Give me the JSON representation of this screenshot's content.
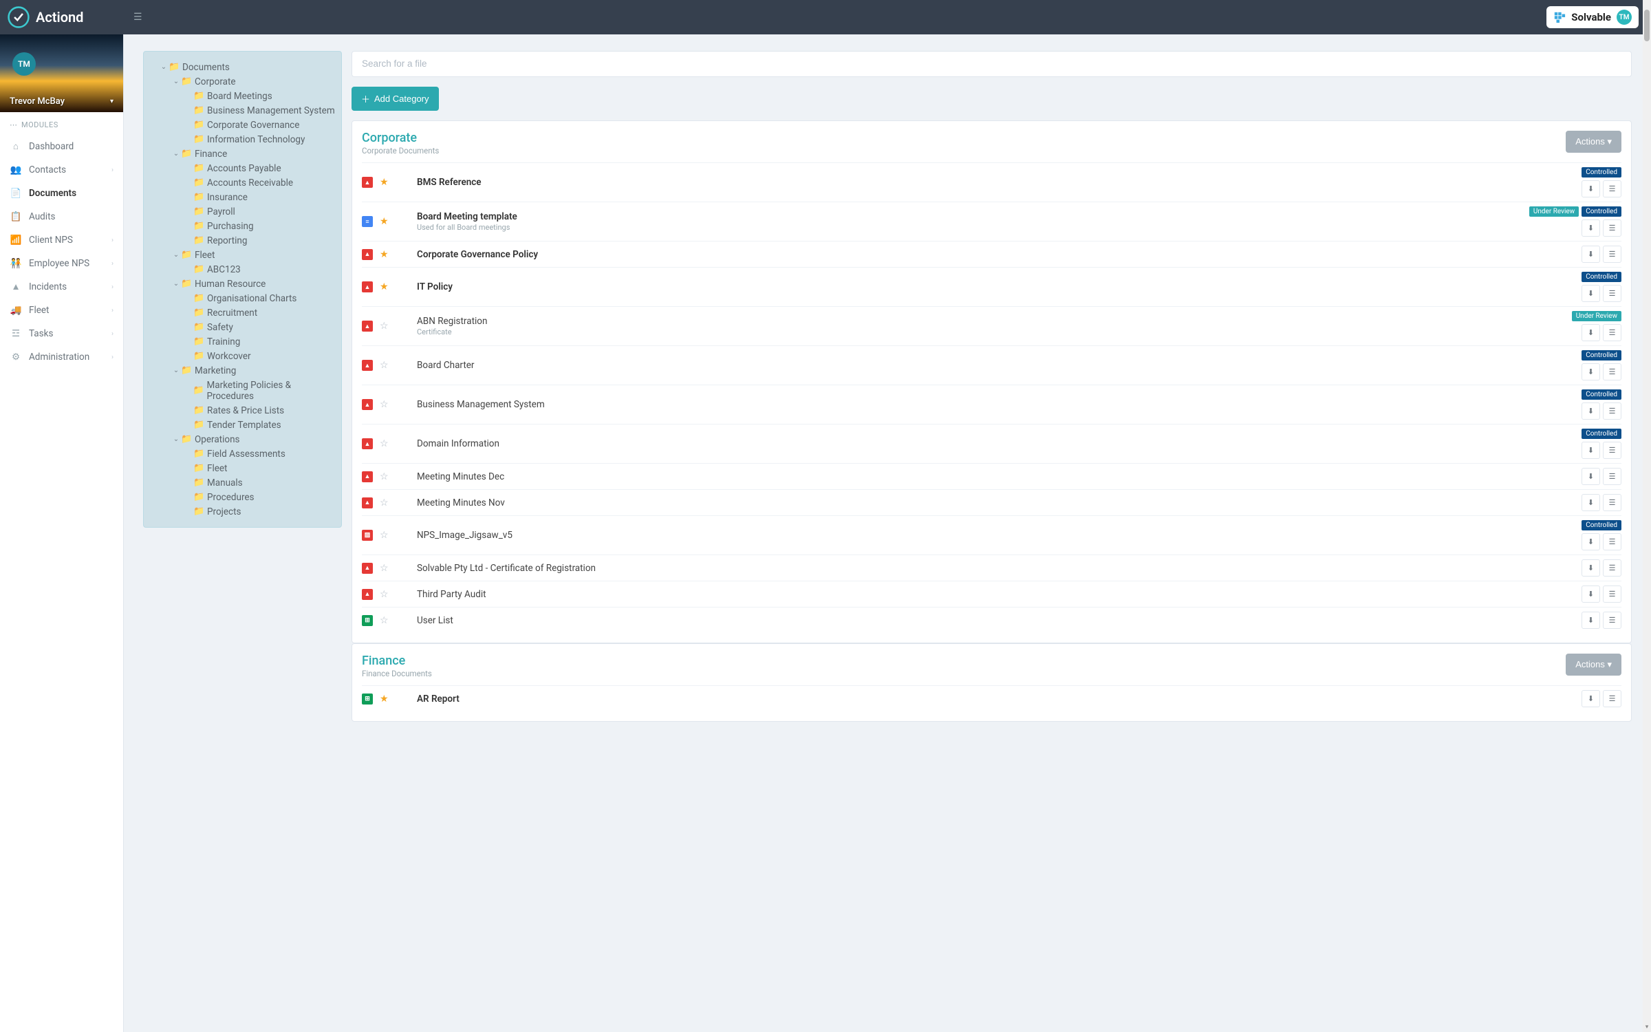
{
  "brand": {
    "name": "Actiond",
    "partner": "Solvable",
    "partner_badge": "TM"
  },
  "user": {
    "initials": "TM",
    "name": "Trevor McBay"
  },
  "sidebar": {
    "section_label": "MODULES",
    "items": [
      {
        "label": "Dashboard",
        "icon": "home-icon",
        "expand": false
      },
      {
        "label": "Contacts",
        "icon": "users-icon",
        "expand": true
      },
      {
        "label": "Documents",
        "icon": "file-icon",
        "expand": false,
        "active": true
      },
      {
        "label": "Audits",
        "icon": "clipboard-icon",
        "expand": false
      },
      {
        "label": "Client NPS",
        "icon": "gauge-icon",
        "expand": true
      },
      {
        "label": "Employee NPS",
        "icon": "group-icon",
        "expand": true
      },
      {
        "label": "Incidents",
        "icon": "warning-icon",
        "expand": true
      },
      {
        "label": "Fleet",
        "icon": "truck-icon",
        "expand": true
      },
      {
        "label": "Tasks",
        "icon": "tasks-icon",
        "expand": true
      },
      {
        "label": "Administration",
        "icon": "cogs-icon",
        "expand": true
      }
    ]
  },
  "tree": {
    "root": "Documents",
    "folders": [
      {
        "name": "Corporate",
        "children": [
          "Board Meetings",
          "Business Management System",
          "Corporate Governance",
          "Information Technology"
        ]
      },
      {
        "name": "Finance",
        "children": [
          "Accounts Payable",
          "Accounts Receivable",
          "Insurance",
          "Payroll",
          "Purchasing",
          "Reporting"
        ]
      },
      {
        "name": "Fleet",
        "children": [
          "ABC123"
        ]
      },
      {
        "name": "Human Resource",
        "children": [
          "Organisational Charts",
          "Recruitment",
          "Safety",
          "Training",
          "Workcover"
        ]
      },
      {
        "name": "Marketing",
        "children": [
          "Marketing Policies & Procedures",
          "Rates & Price Lists",
          "Tender Templates"
        ]
      },
      {
        "name": "Operations",
        "children": [
          "Field Assessments",
          "Fleet",
          "Manuals",
          "Procedures",
          "Projects"
        ]
      }
    ]
  },
  "search": {
    "placeholder": "Search for a file"
  },
  "add_category_label": "Add Category",
  "actions_label": "Actions",
  "categories": [
    {
      "title": "Corporate",
      "subtitle": "Corporate Documents",
      "docs": [
        {
          "name": "BMS Reference",
          "type": "pdf",
          "star": true,
          "bold": true,
          "tags": [
            "Controlled"
          ]
        },
        {
          "name": "Board Meeting template",
          "sub": "Used for all Board meetings",
          "type": "doc",
          "star": true,
          "bold": true,
          "tags": [
            "Under Review",
            "Controlled"
          ]
        },
        {
          "name": "Corporate Governance Policy",
          "type": "pdf",
          "star": true,
          "bold": true,
          "tags": []
        },
        {
          "name": "IT Policy",
          "type": "pdf",
          "star": true,
          "bold": true,
          "tags": [
            "Controlled"
          ]
        },
        {
          "name": "ABN Registration",
          "sub": "Certificate",
          "type": "pdf",
          "star": false,
          "bold": false,
          "tags": [
            "Under Review"
          ]
        },
        {
          "name": "Board Charter",
          "type": "pdf",
          "star": false,
          "bold": false,
          "tags": [
            "Controlled"
          ]
        },
        {
          "name": "Business Management System",
          "type": "pdf",
          "star": false,
          "bold": false,
          "tags": [
            "Controlled"
          ]
        },
        {
          "name": "Domain Information",
          "type": "pdf",
          "star": false,
          "bold": false,
          "tags": [
            "Controlled"
          ]
        },
        {
          "name": "Meeting Minutes Dec",
          "type": "pdf",
          "star": false,
          "bold": false,
          "tags": []
        },
        {
          "name": "Meeting Minutes Nov",
          "type": "pdf",
          "star": false,
          "bold": false,
          "tags": []
        },
        {
          "name": "NPS_Image_Jigsaw_v5",
          "type": "img",
          "star": false,
          "bold": false,
          "tags": [
            "Controlled"
          ]
        },
        {
          "name": "Solvable Pty Ltd - Certificate of Registration",
          "type": "pdf",
          "star": false,
          "bold": false,
          "tags": []
        },
        {
          "name": "Third Party Audit",
          "type": "pdf",
          "star": false,
          "bold": false,
          "tags": []
        },
        {
          "name": "User List",
          "type": "xls",
          "star": false,
          "bold": false,
          "tags": []
        }
      ]
    },
    {
      "title": "Finance",
      "subtitle": "Finance Documents",
      "docs": [
        {
          "name": "AR Report",
          "type": "xls",
          "star": true,
          "bold": true,
          "tags": []
        }
      ]
    }
  ]
}
